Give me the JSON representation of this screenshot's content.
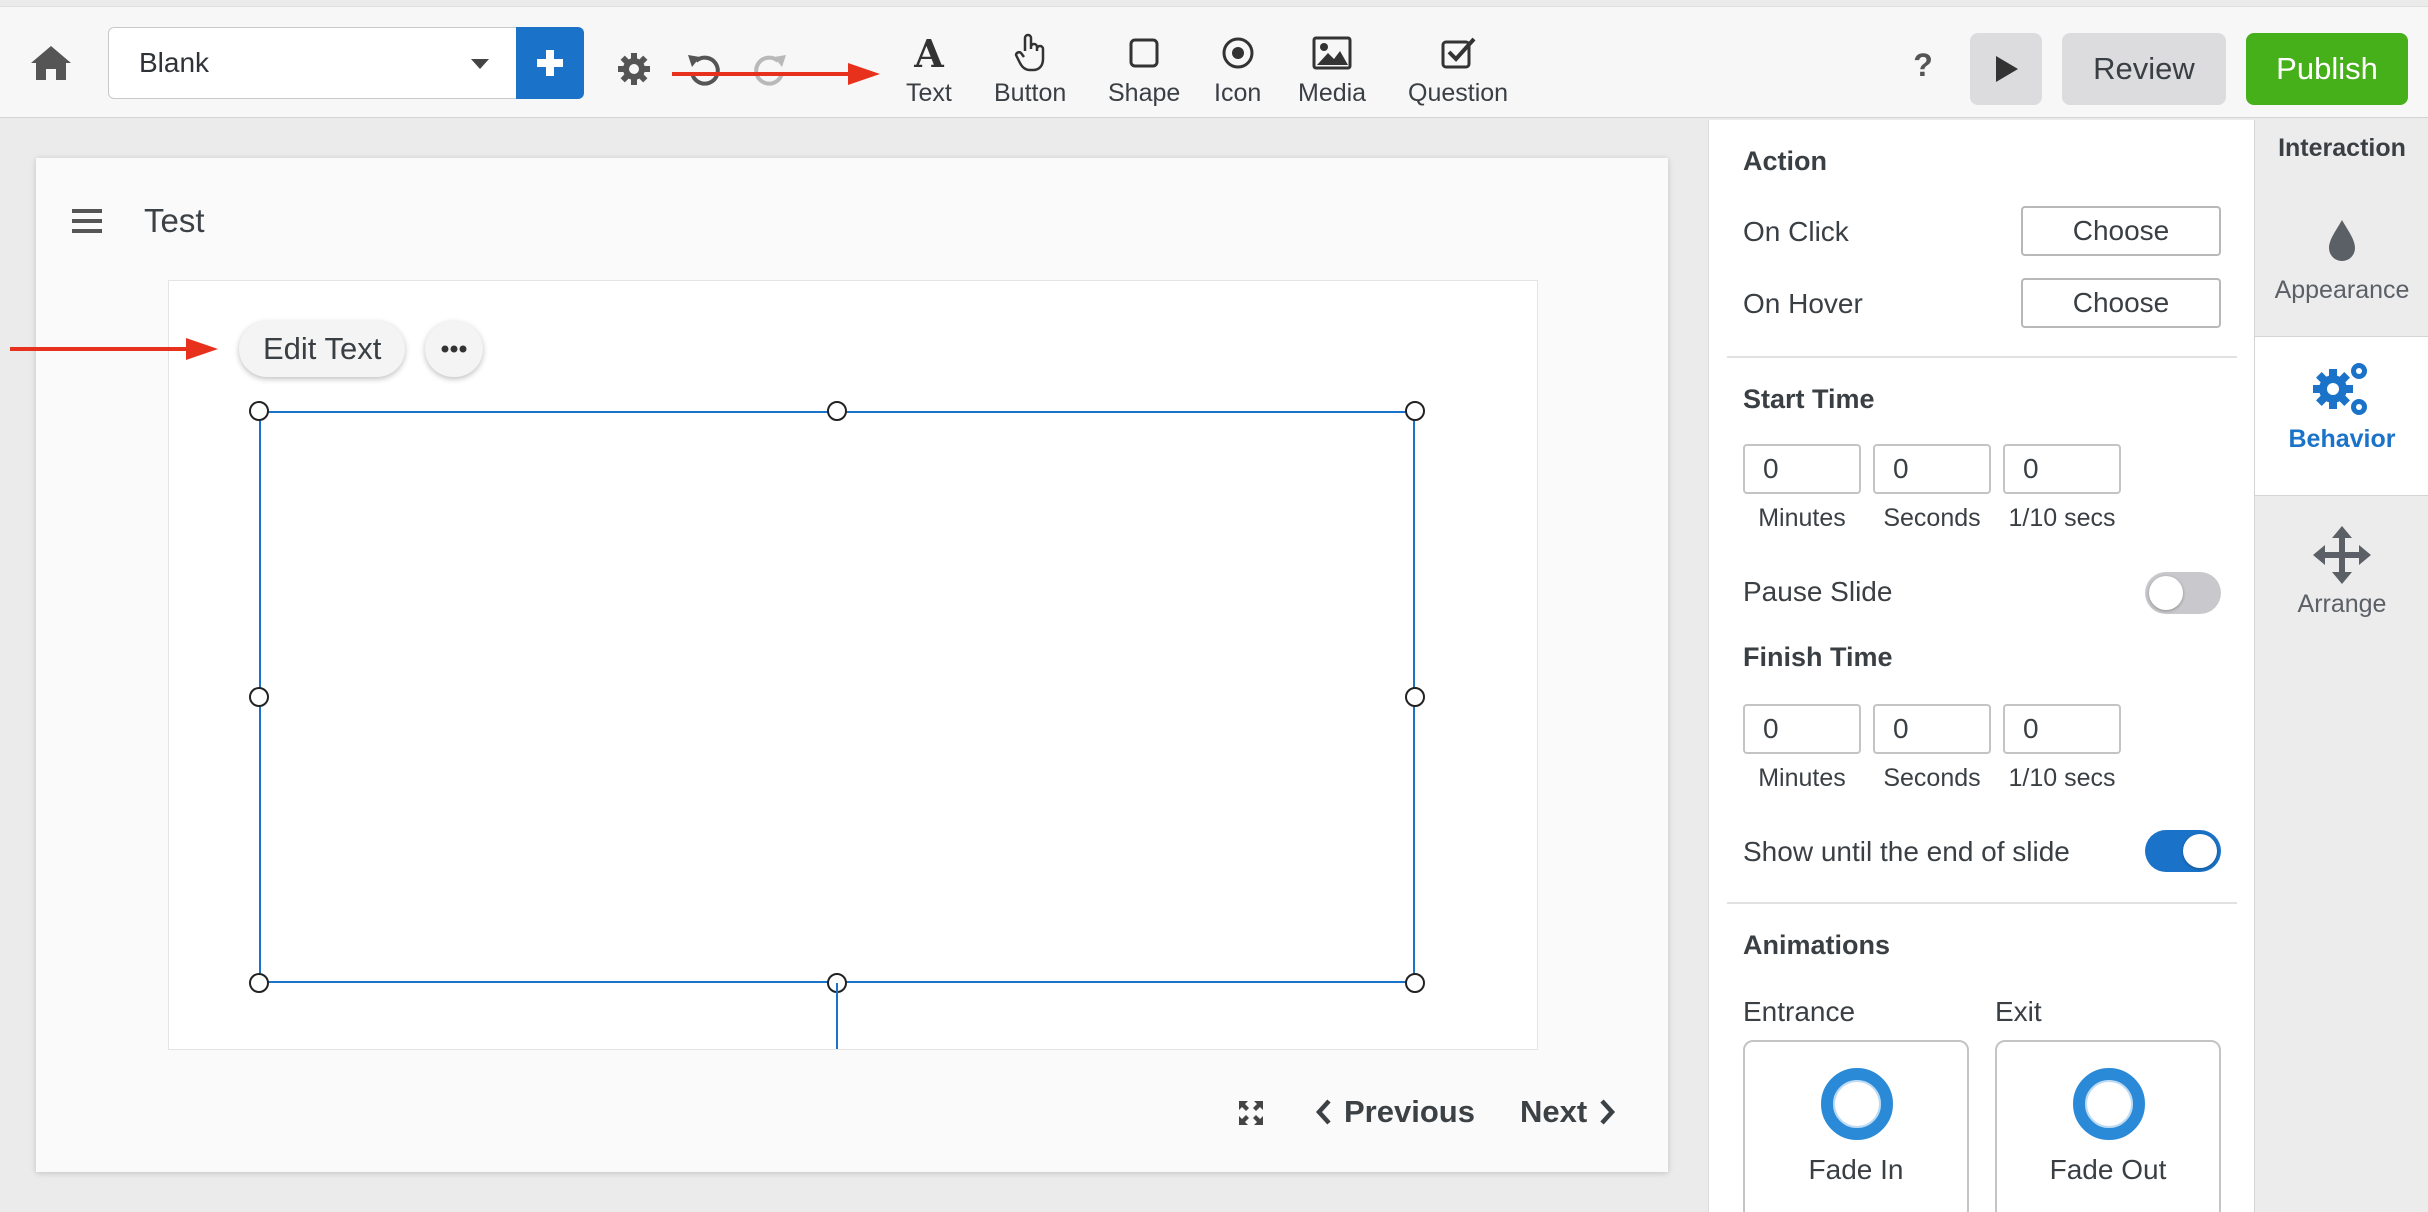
{
  "toolbar": {
    "template_value": "Blank",
    "insert_tools": [
      {
        "label": "Text",
        "icon": "text-icon"
      },
      {
        "label": "Button",
        "icon": "pointer-hand-icon"
      },
      {
        "label": "Shape",
        "icon": "square-icon"
      },
      {
        "label": "Icon",
        "icon": "target-icon"
      },
      {
        "label": "Media",
        "icon": "image-icon"
      },
      {
        "label": "Question",
        "icon": "checkbox-icon"
      }
    ],
    "help_label": "?",
    "review_label": "Review",
    "publish_label": "Publish"
  },
  "canvas": {
    "slide_title": "Test",
    "edit_text_label": "Edit Text",
    "prev_label": "Previous",
    "next_label": "Next"
  },
  "panel": {
    "action_title": "Action",
    "on_click_label": "On Click",
    "on_hover_label": "On Hover",
    "choose_label": "Choose",
    "start_time_title": "Start Time",
    "finish_time_title": "Finish Time",
    "start_minutes": "0",
    "start_seconds": "0",
    "start_tenths": "0",
    "finish_minutes": "0",
    "finish_seconds": "0",
    "finish_tenths": "0",
    "minutes_caption": "Minutes",
    "seconds_caption": "Seconds",
    "tenths_caption": "1/10 secs",
    "pause_slide_label": "Pause Slide",
    "pause_slide_on": false,
    "show_until_end_label": "Show until the end of slide",
    "show_until_end_on": true,
    "animations_title": "Animations",
    "entrance_label": "Entrance",
    "exit_label": "Exit",
    "entrance_value": "Fade In",
    "exit_value": "Fade Out"
  },
  "sidetabs": {
    "header": "Interaction",
    "tabs": [
      {
        "label": "Appearance",
        "icon": "droplet-icon",
        "active": false
      },
      {
        "label": "Behavior",
        "icon": "gears-icon",
        "active": true
      },
      {
        "label": "Arrange",
        "icon": "move-arrows-icon",
        "active": false
      }
    ]
  },
  "colors": {
    "accent": "#1a73c8",
    "publish": "#46b01a",
    "annotation_arrow": "#e8311c"
  }
}
